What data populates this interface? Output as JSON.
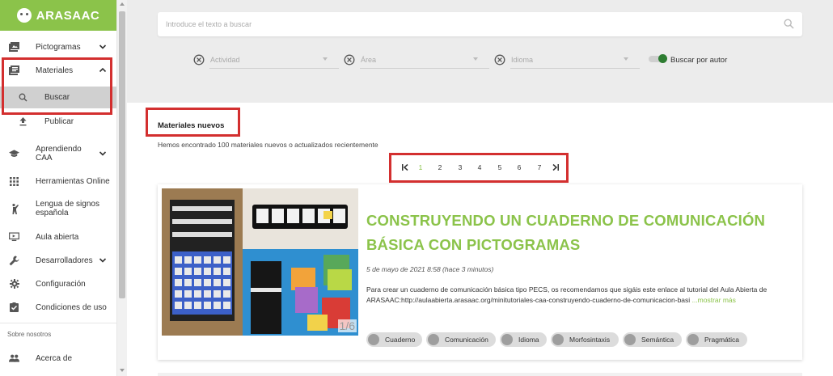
{
  "app": {
    "logo": "ARASAAC",
    "brand_color": "#8bc34a",
    "highlight_color": "#d32f2f"
  },
  "sidebar": {
    "items": [
      {
        "label": "Pictogramas",
        "icon": "image-icon"
      },
      {
        "label": "Materiales",
        "icon": "book-icon"
      },
      {
        "label": "Buscar",
        "icon": "search-icon"
      },
      {
        "label": "Publicar",
        "icon": "upload-icon"
      },
      {
        "label": "Aprendiendo CAA",
        "icon": "graduation-icon"
      },
      {
        "label": "Herramientas Online",
        "icon": "apps-icon"
      },
      {
        "label": "Lengua de signos española",
        "icon": "person-sign-icon"
      },
      {
        "label": "Aula abierta",
        "icon": "screen-icon"
      },
      {
        "label": "Desarrolladores",
        "icon": "wrench-icon"
      },
      {
        "label": "Configuración",
        "icon": "gear-icon"
      },
      {
        "label": "Condiciones de uso",
        "icon": "check-clipboard-icon"
      }
    ],
    "section_label": "Sobre nosotros",
    "about": {
      "label": "Acerca de",
      "icon": "people-icon"
    }
  },
  "search": {
    "placeholder": "Introduce el texto a buscar",
    "filters": [
      {
        "label": "Actividad"
      },
      {
        "label": "Área"
      },
      {
        "label": "Idioma"
      }
    ],
    "author_toggle": {
      "label": "Buscar por autor",
      "on": true
    }
  },
  "new_materials": {
    "title": "Materiales nuevos",
    "found_text": "Hemos encontrado 100 materiales nuevos o actualizados recientemente"
  },
  "pagination": {
    "pages": [
      "1",
      "2",
      "3",
      "4",
      "5",
      "6",
      "7"
    ],
    "current": "1"
  },
  "card": {
    "title": "CONSTRUYENDO UN CUADERNO DE COMUNICACIÓN BÁSICA CON PICTOGRAMAS",
    "date": "5 de mayo de 2021 8:58 (hace 3 minutos)",
    "description": "Para crear un cuaderno de comunicación básica tipo PECS, os recomendamos que sigáis este enlace al tutorial del Aula Abierta de ARASAAC:http://aulaabierta.arasaac.org/minitutoriales-caa-construyendo-cuaderno-de-comunicacion-basi",
    "more": "...mostrar más",
    "image_counter": "1/6",
    "tags": [
      "Cuaderno",
      "Comunicación",
      "Idioma",
      "Morfosintaxis",
      "Semántica",
      "Pragmática"
    ]
  }
}
